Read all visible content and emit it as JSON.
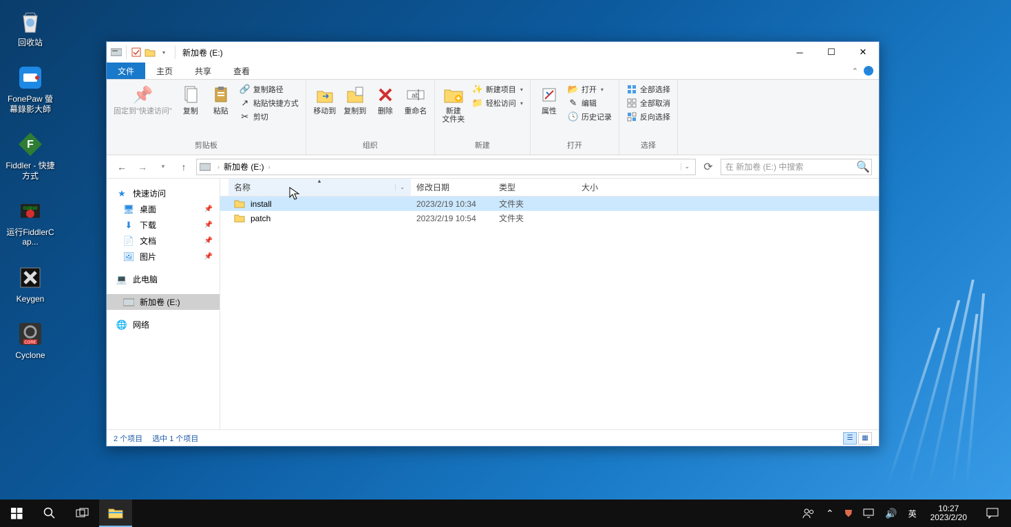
{
  "desktop": [
    {
      "label": "回收站",
      "icon": "recycle"
    },
    {
      "label": "FonePaw 螢幕錄影大師",
      "icon": "fonepaw"
    },
    {
      "label": "Fiddler - 快捷方式",
      "icon": "fiddler"
    },
    {
      "label": "运行FiddlerCap...",
      "icon": "fiddlercap"
    },
    {
      "label": "Keygen",
      "icon": "keygen"
    },
    {
      "label": "Cyclone",
      "icon": "cyclone"
    }
  ],
  "window": {
    "title": "新加卷 (E:)",
    "tabs": {
      "file": "文件",
      "home": "主页",
      "share": "共享",
      "view": "查看"
    },
    "ribbon": {
      "clipboard": {
        "pin": "固定到\"快速访问\"",
        "copy": "复制",
        "paste": "粘贴",
        "copypath": "复制路径",
        "pasteshortcut": "粘贴快捷方式",
        "cut": "剪切",
        "label": "剪贴板"
      },
      "organize": {
        "moveto": "移动到",
        "copyto": "复制到",
        "delete": "删除",
        "rename": "重命名",
        "label": "组织"
      },
      "new": {
        "newfolder": "新建\n文件夹",
        "newitem": "新建项目",
        "easyaccess": "轻松访问",
        "label": "新建"
      },
      "open": {
        "properties": "属性",
        "open": "打开",
        "edit": "编辑",
        "history": "历史记录",
        "label": "打开"
      },
      "select": {
        "selectall": "全部选择",
        "selectnone": "全部取消",
        "invert": "反向选择",
        "label": "选择"
      }
    },
    "address": {
      "crumb": "新加卷 (E:)",
      "search_placeholder": "在 新加卷 (E:) 中搜索"
    },
    "sidebar": {
      "quick": "快速访问",
      "desktop": "桌面",
      "downloads": "下载",
      "documents": "文档",
      "pictures": "图片",
      "thispc": "此电脑",
      "drive": "新加卷 (E:)",
      "network": "网络"
    },
    "columns": {
      "name": "名称",
      "date": "修改日期",
      "type": "类型",
      "size": "大小"
    },
    "files": [
      {
        "name": "install",
        "date": "2023/2/19 10:34",
        "type": "文件夹",
        "size": "",
        "selected": true
      },
      {
        "name": "patch",
        "date": "2023/2/19 10:54",
        "type": "文件夹",
        "size": "",
        "selected": false
      }
    ],
    "status": {
      "items": "2 个项目",
      "selected": "选中 1 个项目"
    }
  },
  "taskbar": {
    "ime": "英",
    "time": "10:27",
    "date": "2023/2/20"
  }
}
